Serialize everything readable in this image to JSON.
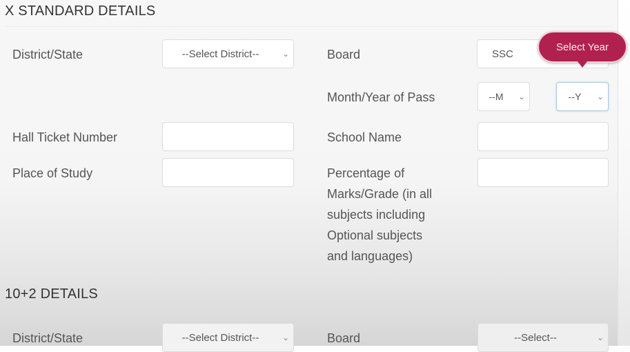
{
  "sections": {
    "x_standard": {
      "title": "X STANDARD DETAILS",
      "district_label": "District/State",
      "district_value": "--Select District--",
      "board_label": "Board",
      "board_value": "SSC",
      "month_year_label": "Month/Year of Pass",
      "month_value": "--M",
      "year_value": "--Y",
      "hall_ticket_label": "Hall Ticket Number",
      "hall_ticket_value": "",
      "school_name_label": "School Name",
      "school_name_value": "",
      "place_label": "Place of Study",
      "place_value": "",
      "percentage_label_lines": [
        "Percentage of",
        "Marks/Grade (in all",
        "subjects including",
        "Optional subjects",
        "and languages)"
      ],
      "percentage_value": ""
    },
    "ten_plus_two": {
      "title": "10+2 DETAILS",
      "district_label": "District/State",
      "district_value": "--Select District--",
      "board_label": "Board",
      "board_value": "--Select--"
    }
  },
  "tooltip": {
    "text": "Select Year",
    "color": "#b1214f"
  },
  "icons": {
    "chevron": "chevron-down-icon"
  }
}
